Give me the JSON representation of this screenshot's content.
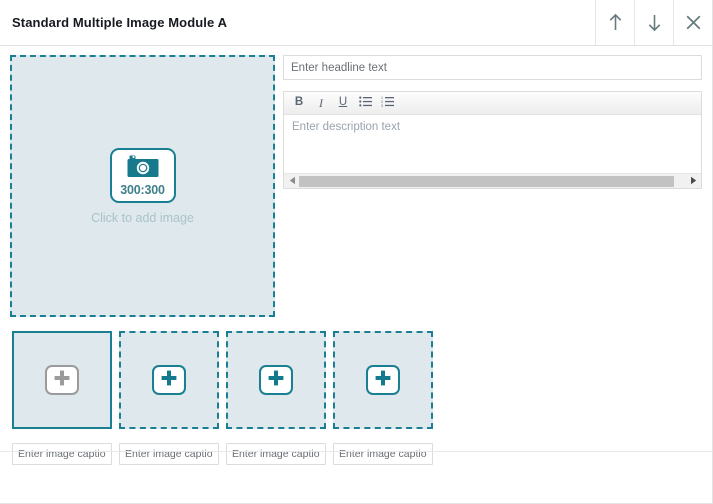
{
  "header": {
    "title": "Standard Multiple Image Module A",
    "actions": [
      {
        "name": "move-up-button",
        "icon": "arrow-up-icon"
      },
      {
        "name": "move-down-button",
        "icon": "arrow-down-icon"
      },
      {
        "name": "close-button",
        "icon": "close-icon"
      }
    ]
  },
  "main_image": {
    "ratio_label": "300:300",
    "caption": "Click to add image",
    "icon": "camera-icon"
  },
  "editor": {
    "headline_placeholder": "Enter headline text",
    "headline_value": "",
    "description_placeholder": "Enter description text",
    "description_value": "",
    "toolbar": [
      {
        "name": "bold-button",
        "label": "B"
      },
      {
        "name": "italic-button",
        "label": "I"
      },
      {
        "name": "underline-button",
        "label": "U"
      },
      {
        "name": "bulleted-list-button",
        "label": ""
      },
      {
        "name": "numbered-list-button",
        "label": ""
      }
    ]
  },
  "thumbnails": [
    {
      "name": "thumbnail-1",
      "state": "active",
      "icon": "plus-icon"
    },
    {
      "name": "thumbnail-2",
      "state": "empty",
      "icon": "plus-icon"
    },
    {
      "name": "thumbnail-3",
      "state": "empty",
      "icon": "plus-icon"
    },
    {
      "name": "thumbnail-4",
      "state": "empty",
      "icon": "plus-icon"
    }
  ],
  "captions": [
    {
      "name": "caption-input-1",
      "placeholder": "Enter image caption",
      "value": ""
    },
    {
      "name": "caption-input-2",
      "placeholder": "Enter image caption",
      "value": ""
    },
    {
      "name": "caption-input-3",
      "placeholder": "Enter image caption",
      "value": ""
    },
    {
      "name": "caption-input-4",
      "placeholder": "Enter image caption",
      "value": ""
    }
  ],
  "colors": {
    "accent_teal": "#1a7f93",
    "dropzone_fill": "#dfe8ec",
    "title_text": "#16191f",
    "placeholder_text": "#6b7076",
    "caption_text": "#a9c3c9"
  }
}
